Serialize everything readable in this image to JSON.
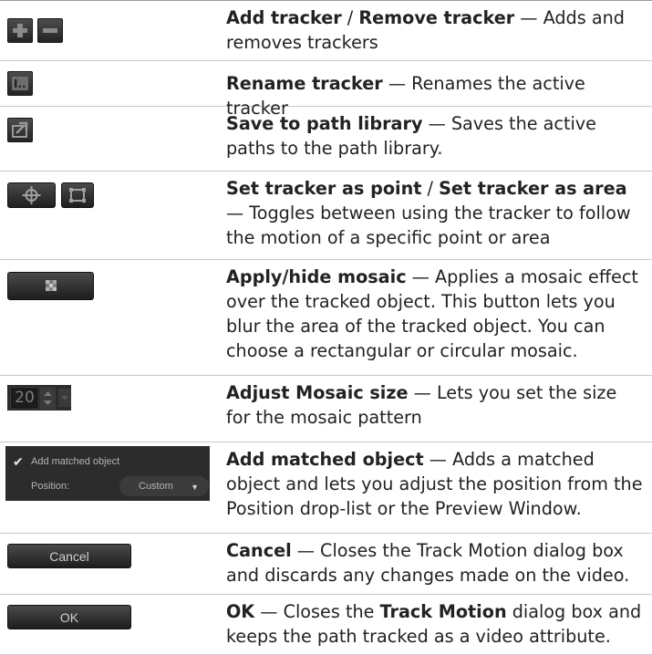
{
  "rows": [
    {
      "title": "Add tracker",
      "sep": " / ",
      "title2": "Remove tracker",
      "desc": " — Adds and removes trackers",
      "icons": [
        "add-tracker-icon",
        "remove-tracker-icon"
      ]
    },
    {
      "title": "Rename tracker",
      "desc": " — Renames the active tracker",
      "icons": [
        "rename-tracker-icon"
      ]
    },
    {
      "title": "Save to path library",
      "desc": " — Saves the active paths to the path library.",
      "icons": [
        "save-to-path-library-icon"
      ]
    },
    {
      "title": "Set tracker as point",
      "sep": " / ",
      "title2": "Set tracker as area",
      "desc": " — Toggles between using the tracker to follow the motion of a specific point or area",
      "icons": [
        "tracker-point-icon",
        "tracker-area-icon"
      ]
    },
    {
      "title": "Apply/hide mosaic",
      "desc": " — Applies a mosaic effect over the tracked object. This button lets you blur the area of the tracked object. You can choose a rectangular or circular mosaic.",
      "icons": [
        "mosaic-icon"
      ]
    },
    {
      "title": "Adjust Mosaic size",
      "desc": " — Lets you set the size for the mosaic pattern",
      "widget": {
        "value": "20"
      }
    },
    {
      "title": "Add matched object",
      "desc": " — Adds a matched object and lets you adjust the position from the Position drop-list or the Preview Window.",
      "widget": {
        "checkbox_label": "Add matched object",
        "position_label": "Position:",
        "position_value": "Custom"
      }
    },
    {
      "title": "Cancel",
      "desc": " — Closes the Track Motion dialog box and discards any changes made on the video.",
      "widget": {
        "button_label": "Cancel"
      }
    },
    {
      "title": "OK",
      "desc_a": " — Closes the ",
      "desc_bold": "Track Motion",
      "desc_b": " dialog box and keeps the path tracked as a video attribute.",
      "widget": {
        "button_label": "OK"
      }
    }
  ]
}
